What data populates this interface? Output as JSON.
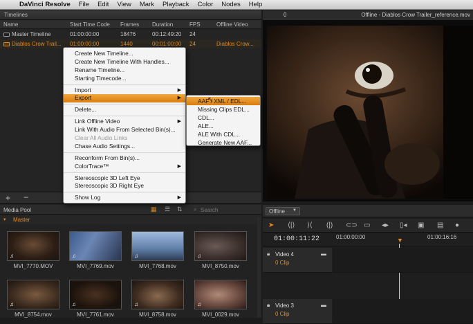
{
  "menubar": {
    "app": "DaVinci Resolve",
    "items": [
      "File",
      "Edit",
      "View",
      "Mark",
      "Playback",
      "Color",
      "Nodes",
      "Help"
    ]
  },
  "timelines": {
    "title": "Timelines",
    "columns": [
      "Name",
      "Start Time Code",
      "Frames",
      "Duration",
      "FPS",
      "Offline Video"
    ],
    "rows": [
      {
        "name": "Master Timeline",
        "start": "01:00:00:00",
        "frames": "18476",
        "duration": "00:12:49:20",
        "fps": "24",
        "offline": ""
      },
      {
        "name": "Diablos Crow Trail...",
        "start": "01:00:00:00",
        "frames": "1440",
        "duration": "00:01:00:00",
        "fps": "24",
        "offline": "Diablos Crow..."
      }
    ]
  },
  "context_menu": {
    "items": [
      {
        "label": "Create New Timeline...",
        "state": "normal"
      },
      {
        "label": "Create New Timeline With Handles...",
        "state": "normal"
      },
      {
        "label": "Rename Timeline...",
        "state": "normal"
      },
      {
        "label": "Starting Timecode...",
        "state": "normal"
      },
      {
        "label": "Import",
        "state": "submenu"
      },
      {
        "label": "Export",
        "state": "highlight"
      },
      {
        "label": "Delete...",
        "state": "normal"
      },
      {
        "label": "Link Offline Video",
        "state": "submenu"
      },
      {
        "label": "Link With Audio From Selected Bin(s)...",
        "state": "normal"
      },
      {
        "label": "Clear All Audio Links",
        "state": "disabled"
      },
      {
        "label": "Chase Audio Settings...",
        "state": "normal"
      },
      {
        "label": "Reconform From Bin(s)...",
        "state": "normal"
      },
      {
        "label": "ColorTrace™",
        "state": "submenu"
      },
      {
        "label": "Stereoscopic 3D Left Eye",
        "state": "normal"
      },
      {
        "label": "Stereoscopic 3D Right Eye",
        "state": "normal"
      },
      {
        "label": "Show Log",
        "state": "submenu"
      }
    ]
  },
  "export_submenu": {
    "items": [
      "AAF / XML / EDL...",
      "Missing Clips EDL...",
      "CDL...",
      "ALE...",
      "ALE With CDL...",
      "Generate New AAF..."
    ]
  },
  "viewer": {
    "counter": "0",
    "title": "Offline - Diablos Crow Trailer_reference.mov"
  },
  "media_pool": {
    "title": "Media Pool",
    "search_placeholder": "Search",
    "bin": "Master",
    "clips": [
      "MVI_7770.MOV",
      "MVI_7769.mov",
      "MVI_7768.mov",
      "MVI_8750.mov",
      "MVI_8754.mov",
      "MVI_7761.mov",
      "MVI_8758.mov",
      "MVI_0029.mov"
    ]
  },
  "timeline_editor": {
    "dropdown": "Offline",
    "current_tc": "01:00:11:22",
    "ruler": [
      "01:00:00:00",
      "01:00:16:16"
    ],
    "tracks": [
      {
        "name": "Video 4",
        "clips": "0 Clip"
      },
      {
        "name": "Video 3",
        "clips": "0 Clip"
      }
    ]
  },
  "colors": {
    "accent": "#e08a1e",
    "menu_highlight": "#e89a2e"
  }
}
